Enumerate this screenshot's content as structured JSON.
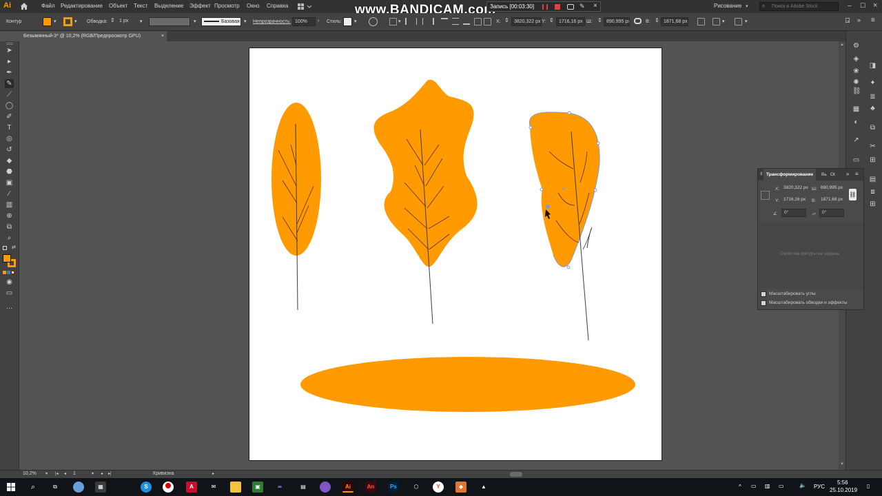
{
  "app": {
    "logo": "Ai",
    "workspace": "Рисование",
    "search_placeholder": "Поиск в Adobe Stock"
  },
  "menu": [
    "Файл",
    "Редактирование",
    "Объект",
    "Текст",
    "Выделение",
    "Эффект",
    "Просмотр",
    "Окно",
    "Справка"
  ],
  "recorder": {
    "watermark": "www.BANDICAM.com",
    "label": "Запись [00:03:30]"
  },
  "control_bar": {
    "selection_label": "Контур",
    "stroke_label": "Обводка:",
    "stroke_value": "1 px",
    "profile_label": "Базовая",
    "opacity_label": "Непрозрачность:",
    "opacity_value": "100%",
    "style_label": "Стиль:",
    "x_label": "X:",
    "x_value": "3820,322 px",
    "y_label": "Y:",
    "y_value": "1716,16 px",
    "w_label": "Ш:",
    "w_value": "890,995 px",
    "h_label": "В:",
    "h_value": "1871,68 px"
  },
  "document_tab": {
    "title": "Безымянный-3* @ 10,2% (RGB/Предпросмотр GPU)",
    "close": "×"
  },
  "colors": {
    "fill": "#ff9a00",
    "vein": "#5a2a3a",
    "stem": "#3a3a3a",
    "artboard": "#ffffff",
    "selection": "#7d9bd1"
  },
  "transform_panel": {
    "tabs": [
      "Трансформирование",
      "Вь",
      "Ot"
    ],
    "x_label": "X:",
    "x_value": "3820,322 px",
    "y_label": "Y:",
    "y_value": "1716,16 px",
    "w_label": "Ш:",
    "w_value": "890,995 px",
    "h_label": "В:",
    "h_value": "1871,68 px",
    "angle_value": "0°",
    "shear_value": "0°",
    "empty_note": "Свойства фигуры не заданы",
    "check1": "Масштабировать углы",
    "check2": "Масштабировать обводки и эффекты"
  },
  "statusbar": {
    "zoom": "10,2%",
    "artboard_num": "1",
    "tool_name": "Кривизна"
  },
  "taskbar": {
    "time": "5:56",
    "date": "25.10.2019",
    "lang": "РУС"
  }
}
